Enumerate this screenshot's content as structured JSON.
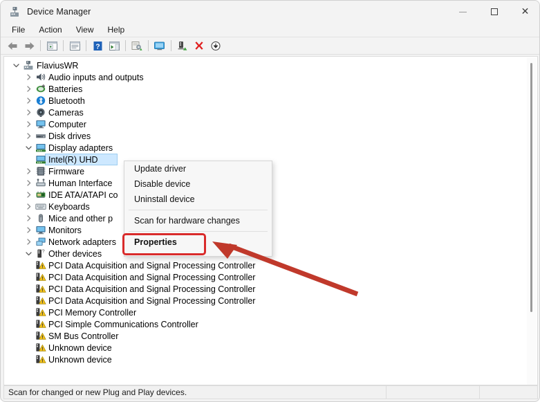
{
  "window": {
    "title": "Device Manager",
    "icon": "device-manager-icon",
    "controls": {
      "minimize": "–",
      "maximize": "□",
      "close": "✕"
    }
  },
  "menubar": {
    "items": [
      {
        "label": "File"
      },
      {
        "label": "Action"
      },
      {
        "label": "View"
      },
      {
        "label": "Help"
      }
    ]
  },
  "toolbar": {
    "items": [
      {
        "name": "back-icon"
      },
      {
        "name": "forward-icon"
      },
      {
        "name": "separator"
      },
      {
        "name": "show-hide-console-tree-icon"
      },
      {
        "name": "separator"
      },
      {
        "name": "properties-icon"
      },
      {
        "name": "separator"
      },
      {
        "name": "help-icon"
      },
      {
        "name": "show-hide-action-pane-icon"
      },
      {
        "name": "separator"
      },
      {
        "name": "update-driver-icon"
      },
      {
        "name": "separator"
      },
      {
        "name": "scan-for-hardware-changes-icon"
      },
      {
        "name": "separator"
      },
      {
        "name": "enable-device-icon"
      },
      {
        "name": "uninstall-device-icon"
      },
      {
        "name": "disable-device-icon"
      }
    ]
  },
  "tree": {
    "rows": [
      {
        "label": "FlaviusWR",
        "depth": 0,
        "chevron": "expanded",
        "icon": "computer-node-icon",
        "selected": false
      },
      {
        "label": "Audio inputs and outputs",
        "depth": 1,
        "chevron": "collapsed",
        "icon": "audio-icon",
        "selected": false
      },
      {
        "label": "Batteries",
        "depth": 1,
        "chevron": "collapsed",
        "icon": "battery-icon",
        "selected": false
      },
      {
        "label": "Bluetooth",
        "depth": 1,
        "chevron": "collapsed",
        "icon": "bluetooth-icon",
        "selected": false
      },
      {
        "label": "Cameras",
        "depth": 1,
        "chevron": "collapsed",
        "icon": "camera-icon",
        "selected": false
      },
      {
        "label": "Computer",
        "depth": 1,
        "chevron": "collapsed",
        "icon": "monitor-icon",
        "selected": false
      },
      {
        "label": "Disk drives",
        "depth": 1,
        "chevron": "collapsed",
        "icon": "disk-drive-icon",
        "selected": false
      },
      {
        "label": "Display adapters",
        "depth": 1,
        "chevron": "expanded",
        "icon": "display-adapter-icon",
        "selected": false
      },
      {
        "label": "Intel(R) UHD",
        "depth": 2,
        "chevron": "none",
        "icon": "display-adapter-icon",
        "selected": true
      },
      {
        "label": "Firmware",
        "depth": 1,
        "chevron": "collapsed",
        "icon": "firmware-icon",
        "selected": false
      },
      {
        "label": "Human Interface",
        "depth": 1,
        "chevron": "collapsed",
        "icon": "hid-icon",
        "selected": false
      },
      {
        "label": "IDE ATA/ATAPI co",
        "depth": 1,
        "chevron": "collapsed",
        "icon": "ide-controller-icon",
        "selected": false
      },
      {
        "label": "Keyboards",
        "depth": 1,
        "chevron": "collapsed",
        "icon": "keyboard-icon",
        "selected": false
      },
      {
        "label": "Mice and other p",
        "depth": 1,
        "chevron": "collapsed",
        "icon": "mouse-icon",
        "selected": false
      },
      {
        "label": "Monitors",
        "depth": 1,
        "chevron": "collapsed",
        "icon": "monitor-icon",
        "selected": false
      },
      {
        "label": "Network adapters",
        "depth": 1,
        "chevron": "collapsed",
        "icon": "network-adapter-icon",
        "selected": false
      },
      {
        "label": "Other devices",
        "depth": 1,
        "chevron": "expanded",
        "icon": "other-device-icon",
        "selected": false
      },
      {
        "label": "PCI Data Acquisition and Signal Processing Controller",
        "depth": 2,
        "chevron": "none",
        "icon": "unknown-device-warning-icon",
        "selected": false
      },
      {
        "label": "PCI Data Acquisition and Signal Processing Controller",
        "depth": 2,
        "chevron": "none",
        "icon": "unknown-device-warning-icon",
        "selected": false
      },
      {
        "label": "PCI Data Acquisition and Signal Processing Controller",
        "depth": 2,
        "chevron": "none",
        "icon": "unknown-device-warning-icon",
        "selected": false
      },
      {
        "label": "PCI Data Acquisition and Signal Processing Controller",
        "depth": 2,
        "chevron": "none",
        "icon": "unknown-device-warning-icon",
        "selected": false
      },
      {
        "label": "PCI Memory Controller",
        "depth": 2,
        "chevron": "none",
        "icon": "unknown-device-warning-icon",
        "selected": false
      },
      {
        "label": "PCI Simple Communications Controller",
        "depth": 2,
        "chevron": "none",
        "icon": "unknown-device-warning-icon",
        "selected": false
      },
      {
        "label": "SM Bus Controller",
        "depth": 2,
        "chevron": "none",
        "icon": "unknown-device-warning-icon",
        "selected": false
      },
      {
        "label": "Unknown device",
        "depth": 2,
        "chevron": "none",
        "icon": "unknown-device-warning-icon",
        "selected": false
      },
      {
        "label": "Unknown device",
        "depth": 2,
        "chevron": "none",
        "icon": "unknown-device-warning-icon",
        "selected": false
      }
    ]
  },
  "context_menu": {
    "items": [
      {
        "label": "Update driver",
        "type": "item",
        "bold": false
      },
      {
        "label": "Disable device",
        "type": "item",
        "bold": false
      },
      {
        "label": "Uninstall device",
        "type": "item",
        "bold": false
      },
      {
        "label": "",
        "type": "separator",
        "bold": false
      },
      {
        "label": "Scan for hardware changes",
        "type": "item",
        "bold": false
      },
      {
        "label": "",
        "type": "separator",
        "bold": false
      },
      {
        "label": "Properties",
        "type": "item",
        "bold": true
      }
    ]
  },
  "statusbar": {
    "message": "Scan for changed or new Plug and Play devices.",
    "cell2": "",
    "cell3": ""
  },
  "annotations": {
    "highlight_color": "#d92b2b",
    "arrow_color": "#c0392b",
    "target": "Properties"
  }
}
